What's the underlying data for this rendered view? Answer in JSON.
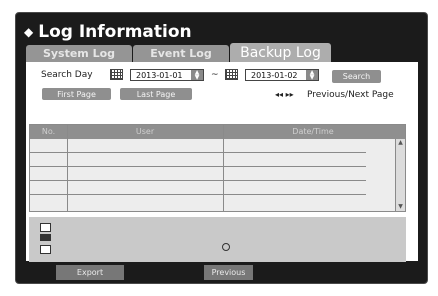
{
  "window": {
    "title": "Log Information"
  },
  "tabs": [
    {
      "label": "System Log"
    },
    {
      "label": "Event Log"
    },
    {
      "label": "Backup Log"
    }
  ],
  "search": {
    "label": "Search Day",
    "start_date": "2013-01-01",
    "separator": "~",
    "end_date": "2013-01-02",
    "button": "Search"
  },
  "paging": {
    "first": "First Page",
    "last": "Last Page",
    "nav_arrows": "◂◂ ▸▸",
    "nav_label": "Previous/Next Page"
  },
  "table": {
    "columns": [
      "No.",
      "User",
      "Date/Time"
    ],
    "rows": [
      "",
      "",
      "",
      "",
      ""
    ]
  },
  "detail": {
    "icons": [
      "calendar-icon",
      "backup-device-icon",
      "windows-icon"
    ]
  },
  "footer": {
    "export": "Export",
    "previous": "Previous"
  }
}
